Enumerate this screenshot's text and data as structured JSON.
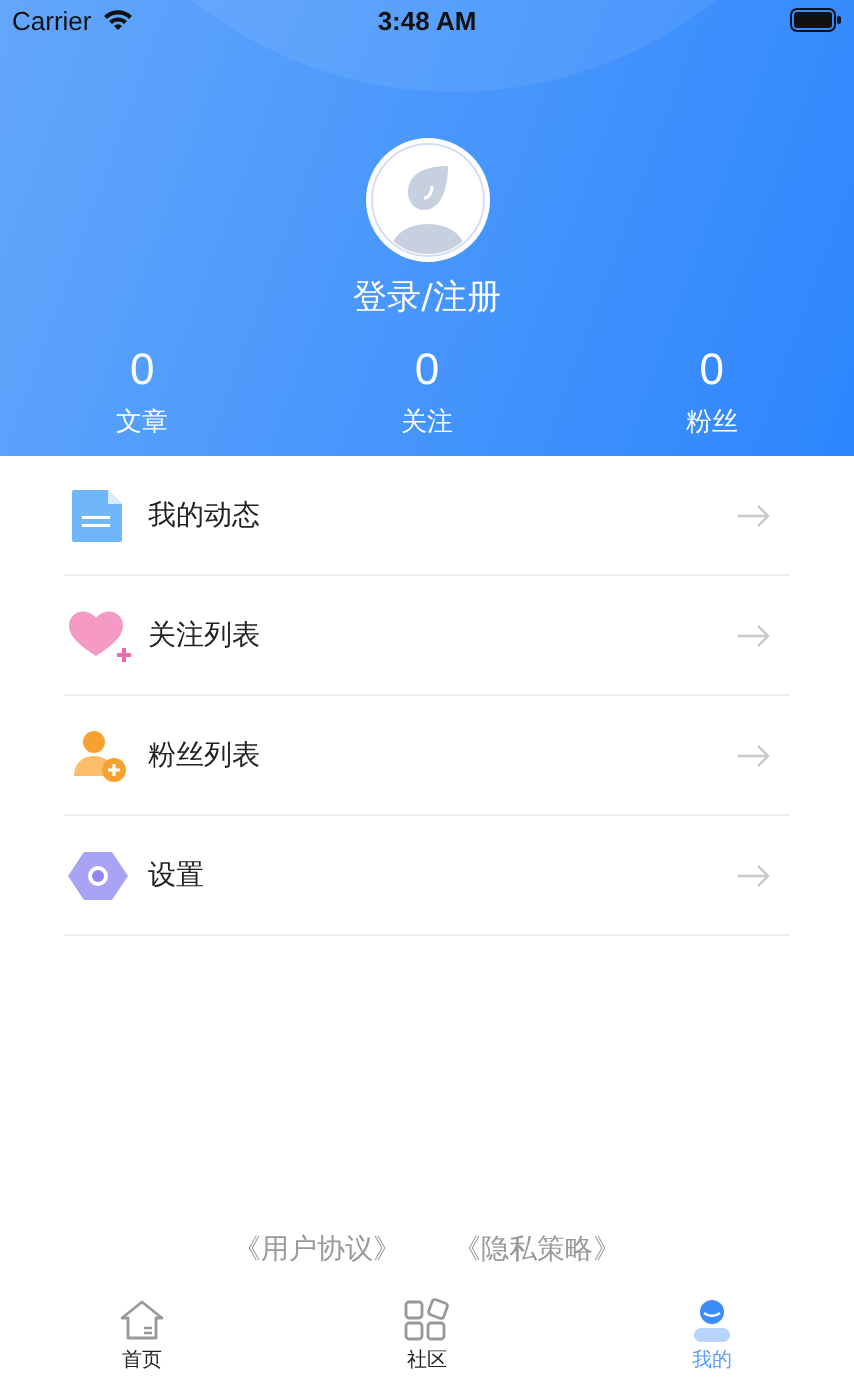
{
  "status_bar": {
    "carrier": "Carrier",
    "time": "3:48 AM"
  },
  "profile": {
    "login": "登录/注册",
    "stats": [
      {
        "value": "0",
        "label": "文章"
      },
      {
        "value": "0",
        "label": "关注"
      },
      {
        "value": "0",
        "label": "粉丝"
      }
    ]
  },
  "menu": [
    {
      "label": "我的动态"
    },
    {
      "label": "关注列表"
    },
    {
      "label": "粉丝列表"
    },
    {
      "label": "设置"
    }
  ],
  "links": [
    "《用户协议》",
    "《隐私策略》"
  ],
  "tabs": [
    {
      "label": "首页",
      "selected": false
    },
    {
      "label": "社区",
      "selected": false
    },
    {
      "label": "我的",
      "selected": true
    }
  ]
}
